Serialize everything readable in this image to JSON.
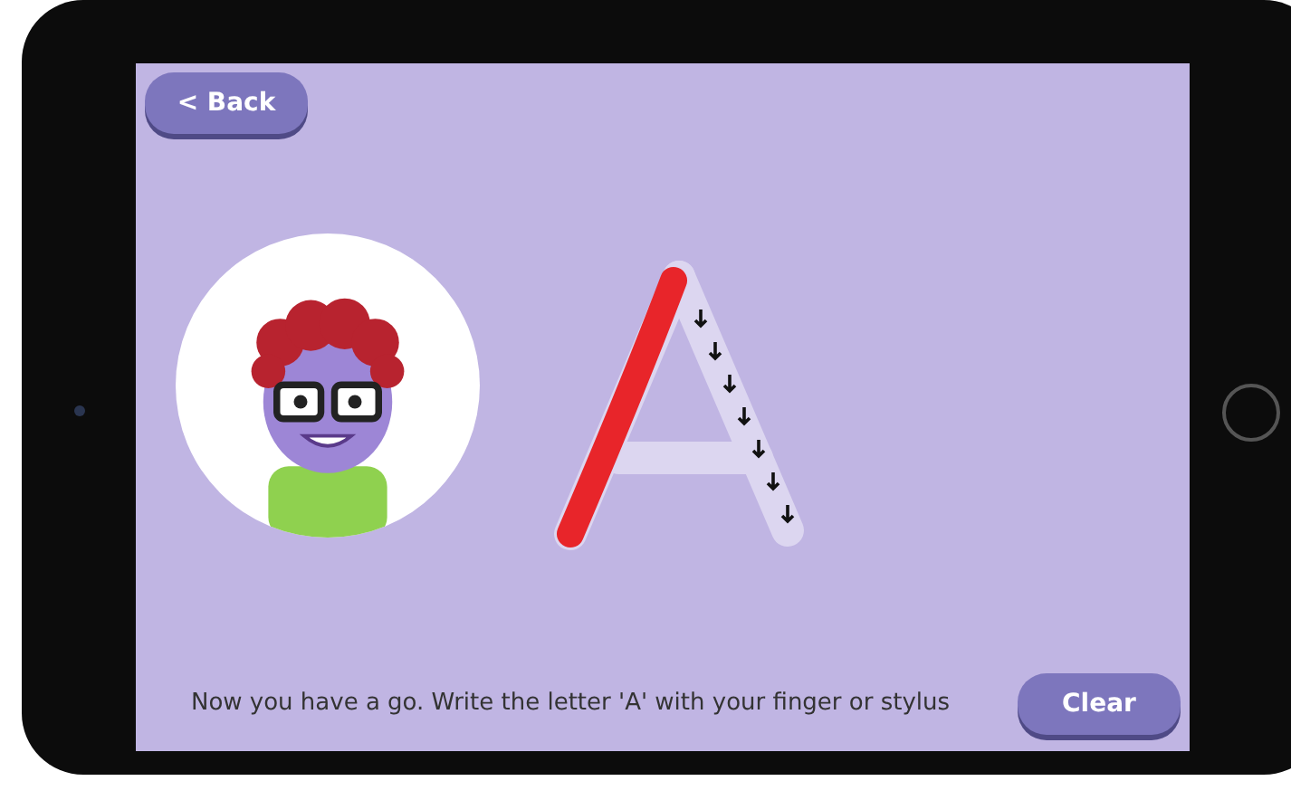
{
  "back_button": {
    "label": "< Back"
  },
  "instruction": "Now you have a go. Write the letter 'A' with your finger or stylus",
  "clear_button": {
    "label": "Clear"
  }
}
